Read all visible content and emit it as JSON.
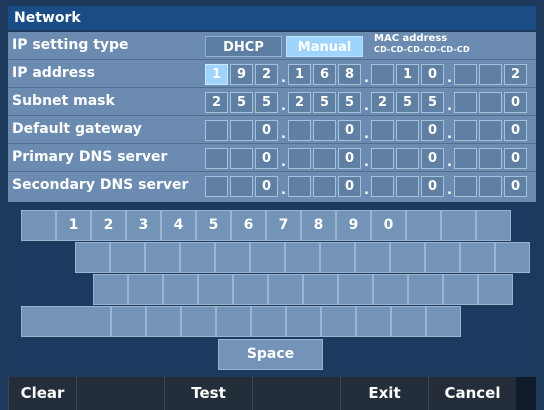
{
  "title": "Network",
  "rows": {
    "ip_setting_type": {
      "label": "IP setting type",
      "options": [
        "DHCP",
        "Manual"
      ],
      "selected": "Manual"
    },
    "ip_address": {
      "label": "IP address"
    },
    "subnet_mask": {
      "label": "Subnet mask"
    },
    "default_gateway": {
      "label": "Default gateway"
    },
    "primary_dns": {
      "label": "Primary DNS server"
    },
    "secondary_dns": {
      "label": "Secondary DNS server"
    }
  },
  "mac": {
    "label": "MAC address",
    "value": "CD-CD-CD-CD-CD-CD"
  },
  "fields": {
    "ip_address": [
      [
        "1",
        "9",
        "2"
      ],
      [
        "1",
        "6",
        "8"
      ],
      [
        "",
        "1",
        "0"
      ],
      [
        "",
        "",
        "2"
      ]
    ],
    "subnet_mask": [
      [
        "2",
        "5",
        "5"
      ],
      [
        "2",
        "5",
        "5"
      ],
      [
        "2",
        "5",
        "5"
      ],
      [
        "",
        "",
        "0"
      ]
    ],
    "default_gateway": [
      [
        "",
        "",
        "0"
      ],
      [
        "",
        "",
        "0"
      ],
      [
        "",
        "",
        "0"
      ],
      [
        "",
        "",
        "0"
      ]
    ],
    "primary_dns": [
      [
        "",
        "",
        "0"
      ],
      [
        "",
        "",
        "0"
      ],
      [
        "",
        "",
        "0"
      ],
      [
        "",
        "",
        "0"
      ]
    ],
    "secondary_dns": [
      [
        "",
        "",
        "0"
      ],
      [
        "",
        "",
        "0"
      ],
      [
        "",
        "",
        "0"
      ],
      [
        "",
        "",
        "0"
      ]
    ]
  },
  "keyboard": {
    "digits": [
      "1",
      "2",
      "3",
      "4",
      "5",
      "6",
      "7",
      "8",
      "9",
      "0"
    ],
    "space": "Space"
  },
  "function_keys": [
    "Clear",
    "",
    "Test",
    "",
    "Exit",
    "Cancel"
  ],
  "colors": {
    "title_bar": "#1a4c86",
    "panel": "#6b8cb0",
    "selected": "#9fd4ff",
    "keyboard_bg": "#1a3a60"
  }
}
